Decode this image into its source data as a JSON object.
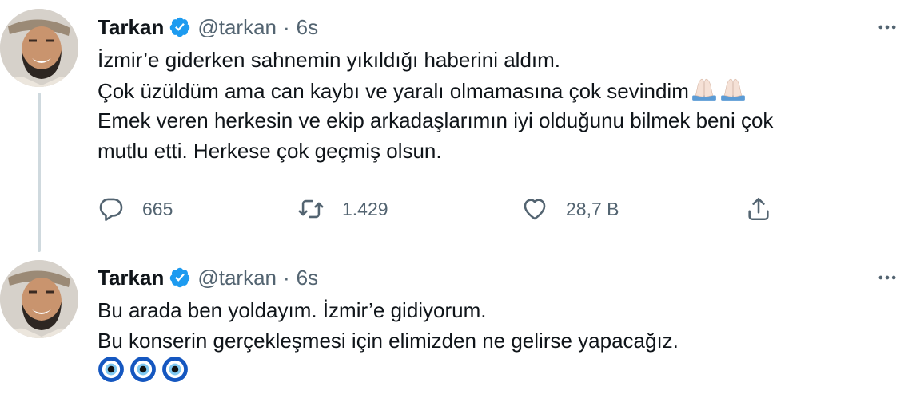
{
  "tweets": [
    {
      "author": {
        "name": "Tarkan",
        "handle": "@tarkan",
        "verified": true
      },
      "separator": "·",
      "time": "6s",
      "lines": [
        "İzmir’e giderken sahnemin yıkıldığı haberini aldım.",
        "Çok üzüldüm ama can kaybı ve yaralı olmamasına çok sevindim",
        "Emek veren herkesin ve ekip arkadaşlarımın iyi olduğunu bilmek beni çok",
        "mutlu etti. Herkese çok geçmiş olsun."
      ],
      "emoji_after_line_2": [
        "folded-hands",
        "folded-hands"
      ],
      "stats": {
        "replies": "665",
        "retweets": "1.429",
        "likes": "28,7 B"
      }
    },
    {
      "author": {
        "name": "Tarkan",
        "handle": "@tarkan",
        "verified": true
      },
      "separator": "·",
      "time": "6s",
      "lines": [
        "Bu arada ben yoldayım. İzmir’e gidiyorum.",
        "Bu konserin gerçekleşmesi için elimizden ne gelirse yapacağız."
      ],
      "emoji_line": [
        "nazar-amulet",
        "nazar-amulet",
        "nazar-amulet"
      ]
    }
  ],
  "icons": {
    "verified": "verified-badge-icon",
    "more": "more-icon",
    "reply": "reply-icon",
    "retweet": "retweet-icon",
    "like": "heart-icon",
    "share": "share-icon"
  },
  "colors": {
    "text": "#0f1419",
    "secondary": "#536471",
    "verified": "#1d9bf0",
    "thread_line": "#cfd9de"
  }
}
